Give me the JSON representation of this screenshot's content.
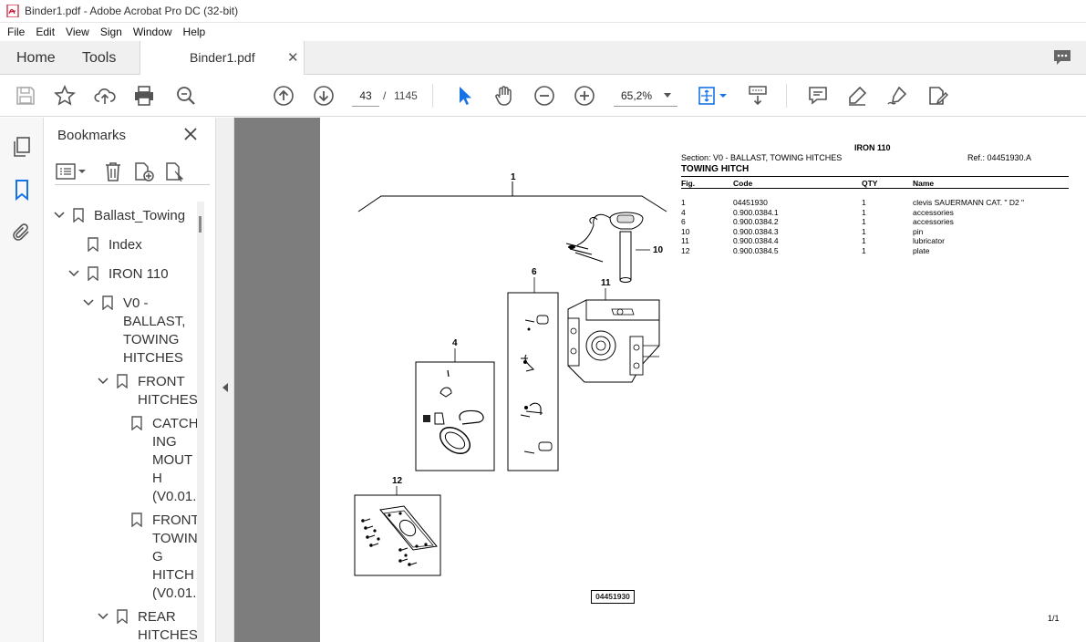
{
  "window": {
    "title": "Binder1.pdf - Adobe Acrobat Pro DC (32-bit)"
  },
  "menu": [
    "File",
    "Edit",
    "View",
    "Sign",
    "Window",
    "Help"
  ],
  "tabs": {
    "home": "Home",
    "tools": "Tools",
    "document": "Binder1.pdf"
  },
  "toolbar": {
    "current_page": "43",
    "slash": "/",
    "total_pages": "1145",
    "zoom": "65,2%"
  },
  "bookmarks": {
    "title": "Bookmarks",
    "items": [
      {
        "label": "Ballast_Towing"
      },
      {
        "label": "Index"
      },
      {
        "label": "IRON 110"
      },
      {
        "label": "V0 -\nBALLAST,\nTOWING\nHITCHES"
      },
      {
        "label": "FRONT\nHITCHES"
      },
      {
        "label": "CATCH\nING\nMOUT\nH\n(V0.01."
      },
      {
        "label": "FRONT\nTOWIN\nG\nHITCH\n(V0.01."
      },
      {
        "label": "REAR\nHITCHES"
      }
    ]
  },
  "document": {
    "model": "IRON 110",
    "section": "Section: V0 - BALLAST, TOWING HITCHES",
    "ref": "Ref.: 04451930.A",
    "heading": "TOWING HITCH",
    "columns": [
      "Fig.",
      "Code",
      "QTY",
      "Name"
    ],
    "rows": [
      [
        "1",
        "04451930",
        "1",
        "clevis SAUERMANN CAT. \" D2 \""
      ],
      [
        "4",
        "0.900.0384.1",
        "1",
        "accessories"
      ],
      [
        "6",
        "0.900.0384.2",
        "1",
        "accessories"
      ],
      [
        "10",
        "0.900.0384.3",
        "1",
        "pin"
      ],
      [
        "11",
        "0.900.0384.4",
        "1",
        "lubricator"
      ],
      [
        "12",
        "0.900.0384.5",
        "1",
        "plate"
      ]
    ],
    "callouts": [
      "1",
      "4",
      "6",
      "10",
      "11",
      "12"
    ],
    "figure_code": "04451930",
    "page_indicator": "1/1"
  }
}
